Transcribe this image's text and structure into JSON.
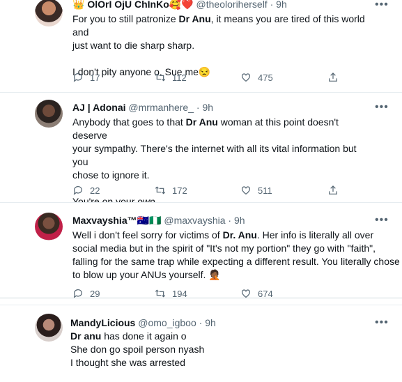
{
  "tweets": [
    {
      "display_name": "OlOrI OjU ChInKo",
      "name_emojis": "🥰❤️",
      "handle": "@theoloriherself",
      "time": "9h",
      "lines": [
        [
          "For you to still patronize ",
          "Dr Anu",
          ", it means you are tired of this world and"
        ],
        [
          "just want to die sharp sharp.",
          "",
          ""
        ],
        [
          "",
          "",
          ""
        ],
        [
          "I don't pity anyone o. Sue me😒",
          "",
          ""
        ]
      ],
      "replies": "17",
      "retweets": "112",
      "likes": "475"
    },
    {
      "display_name": "AJ | Adonai",
      "handle": "@mrmanhere_",
      "time": "9h",
      "lines": [
        [
          "Anybody that goes to that ",
          "Dr Anu",
          " woman at this point doesn't deserve"
        ],
        [
          "your sympathy. There's the internet with all its vital information but you",
          "",
          ""
        ],
        [
          "chose to ignore it.",
          "",
          ""
        ],
        [
          "",
          "",
          ""
        ],
        [
          "You're on your own.",
          "",
          ""
        ]
      ],
      "replies": "22",
      "retweets": "172",
      "likes": "511"
    },
    {
      "display_name": "Maxvayshia™",
      "name_emojis": "🇦🇺🇳🇬",
      "handle": "@maxvayshia",
      "time": "9h",
      "lines": [
        [
          "Well i don't feel sorry for victims of ",
          "Dr. Anu",
          ". Her info is literally all over"
        ],
        [
          "social media but in the spirit of \"It's not my portion\" they go with \"faith\",",
          "",
          ""
        ],
        [
          "falling for the same trap while expecting a different result. You literally chose",
          "",
          ""
        ],
        [
          "to blow up your ANUs yourself. 🤦🏾",
          "",
          ""
        ]
      ],
      "replies": "29",
      "retweets": "194",
      "likes": "674"
    },
    {
      "display_name": "MandyLicious",
      "handle": "@omo_igboo",
      "time": "9h",
      "lines": [
        [
          "",
          "Dr anu",
          " has done it again o"
        ],
        [
          "She don go spoil person nyash",
          "",
          ""
        ],
        [
          "I thought she was arrested",
          "",
          ""
        ]
      ]
    }
  ],
  "separator": "·",
  "icons": [
    "reply-icon",
    "retweet-icon",
    "like-icon",
    "share-icon",
    "more-icon"
  ],
  "colors": {
    "text": "#0f1419",
    "muted": "#536471",
    "divider": "#e6ecf0"
  }
}
